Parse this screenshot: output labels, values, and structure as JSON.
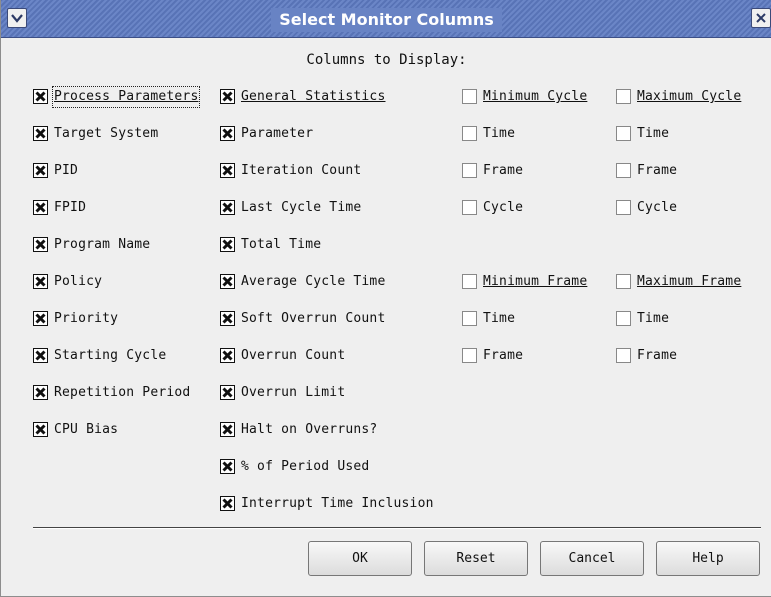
{
  "window": {
    "title": "Select Monitor Columns"
  },
  "heading": "Columns to Display:",
  "columns": [
    {
      "items": [
        {
          "label": "Process Parameters",
          "checked": true,
          "underline": true
        },
        {
          "label": "Target System",
          "checked": true
        },
        {
          "label": "PID",
          "checked": true
        },
        {
          "label": "FPID",
          "checked": true
        },
        {
          "label": "Program Name",
          "checked": true
        },
        {
          "label": "Policy",
          "checked": true
        },
        {
          "label": "Priority",
          "checked": true
        },
        {
          "label": "Starting Cycle",
          "checked": true
        },
        {
          "label": "Repetition Period",
          "checked": true
        },
        {
          "label": "CPU Bias",
          "checked": true
        }
      ]
    },
    {
      "items": [
        {
          "label": "General Statistics",
          "checked": true,
          "underline": true
        },
        {
          "label": "Parameter",
          "checked": true
        },
        {
          "label": "Iteration Count",
          "checked": true
        },
        {
          "label": "Last Cycle Time",
          "checked": true
        },
        {
          "label": "Total Time",
          "checked": true
        },
        {
          "label": "Average Cycle Time",
          "checked": true
        },
        {
          "label": "Soft Overrun Count",
          "checked": true
        },
        {
          "label": "Overrun Count",
          "checked": true
        },
        {
          "label": "Overrun Limit",
          "checked": true
        },
        {
          "label": "Halt on Overruns?",
          "checked": true
        },
        {
          "label": "% of Period Used",
          "checked": true
        },
        {
          "label": "Interrupt Time Inclusion",
          "checked": true
        }
      ]
    },
    {
      "items": [
        {
          "label": "Minimum Cycle",
          "checked": false,
          "underline": true
        },
        {
          "label": "Time",
          "checked": false
        },
        {
          "label": "Frame",
          "checked": false
        },
        {
          "label": "Cycle",
          "checked": false
        },
        {
          "label": "",
          "checked": false,
          "empty": true
        },
        {
          "label": "Minimum Frame",
          "checked": false,
          "underline": true
        },
        {
          "label": "Time",
          "checked": false
        },
        {
          "label": "Frame",
          "checked": false
        }
      ]
    },
    {
      "items": [
        {
          "label": "Maximum Cycle",
          "checked": false,
          "underline": true
        },
        {
          "label": "Time",
          "checked": false
        },
        {
          "label": "Frame",
          "checked": false
        },
        {
          "label": "Cycle",
          "checked": false
        },
        {
          "label": "",
          "checked": false,
          "empty": true
        },
        {
          "label": "Maximum Frame",
          "checked": false,
          "underline": true
        },
        {
          "label": "Time",
          "checked": false
        },
        {
          "label": "Frame",
          "checked": false
        }
      ]
    }
  ],
  "buttons": {
    "ok": "OK",
    "reset": "Reset",
    "cancel": "Cancel",
    "help": "Help"
  },
  "icons": {
    "menu": "chevron-down-icon",
    "close": "close-icon",
    "check": "check-x-icon"
  },
  "colors": {
    "titlebar": "#6b86c7",
    "title_text": "#ffffff",
    "dialog_bg": "#efefef"
  }
}
